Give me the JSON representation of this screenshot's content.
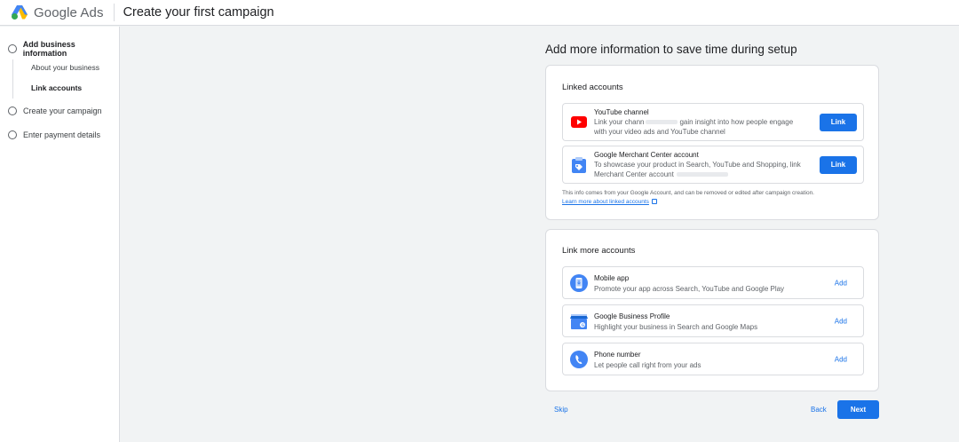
{
  "app": {
    "brand": "Google Ads",
    "page_title": "Create your first campaign"
  },
  "sidebar": {
    "steps": [
      {
        "label": "Add business information",
        "active": true
      },
      {
        "label": "Create your campaign",
        "active": false
      },
      {
        "label": "Enter payment details",
        "active": false
      }
    ],
    "substeps": [
      {
        "label": "About your business",
        "active": false
      },
      {
        "label": "Link accounts",
        "active": true
      }
    ]
  },
  "main": {
    "heading": "Add more information to save time during setup",
    "linked": {
      "title": "Linked accounts",
      "items": [
        {
          "icon": "youtube-icon",
          "title": "YouTube channel",
          "desc_prefix": "Link your chann",
          "desc_suffix": "gain insight into how people engage",
          "desc_line2": "with your video ads and YouTube channel",
          "button": "Link"
        },
        {
          "icon": "merchant-center-icon",
          "title": "Google Merchant Center account",
          "desc_line1": "To showcase your product in Search, YouTube and Shopping, link",
          "desc_line2": "Merchant Center account",
          "button": "Link"
        }
      ],
      "note": "This info comes from your Google Account, and can be removed or edited after campaign creation.",
      "learn_more": "Learn more about linked accounts"
    },
    "more": {
      "title": "Link more accounts",
      "items": [
        {
          "icon": "mobile-app-icon",
          "title": "Mobile app",
          "desc": "Promote your app across Search, YouTube and Google Play",
          "button": "Add"
        },
        {
          "icon": "business-profile-icon",
          "title": "Google Business Profile",
          "desc": "Highlight your business in Search and Google Maps",
          "button": "Add"
        },
        {
          "icon": "phone-icon",
          "title": "Phone number",
          "desc": "Let people call right from your ads",
          "button": "Add"
        }
      ]
    }
  },
  "footer": {
    "skip": "Skip",
    "back": "Back",
    "next": "Next"
  },
  "colors": {
    "accent": "#1a73e8",
    "youtube": "#ff0000",
    "icon_blue": "#4285f4"
  }
}
